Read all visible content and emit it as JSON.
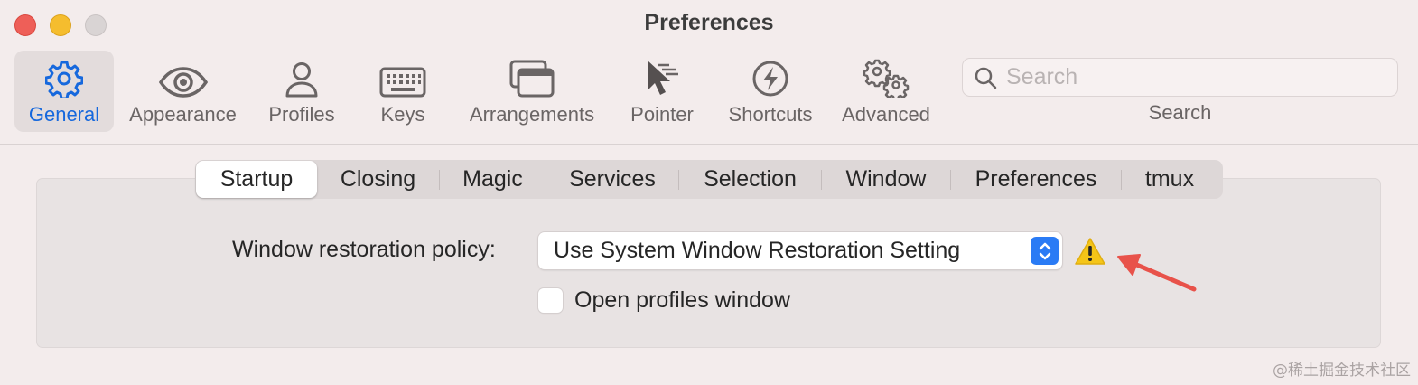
{
  "window": {
    "title": "Preferences"
  },
  "toolbar": {
    "items": [
      {
        "label": "General",
        "icon": "gear-icon",
        "active": true
      },
      {
        "label": "Appearance",
        "icon": "eye-icon",
        "active": false
      },
      {
        "label": "Profiles",
        "icon": "person-icon",
        "active": false
      },
      {
        "label": "Keys",
        "icon": "keyboard-icon",
        "active": false
      },
      {
        "label": "Arrangements",
        "icon": "windows-stack-icon",
        "active": false
      },
      {
        "label": "Pointer",
        "icon": "pointer-icon",
        "active": false
      },
      {
        "label": "Shortcuts",
        "icon": "lightning-icon",
        "active": false
      },
      {
        "label": "Advanced",
        "icon": "gears-icon",
        "active": false
      }
    ],
    "search": {
      "placeholder": "Search",
      "caption": "Search"
    }
  },
  "tabs": [
    {
      "label": "Startup",
      "active": true
    },
    {
      "label": "Closing",
      "active": false
    },
    {
      "label": "Magic",
      "active": false
    },
    {
      "label": "Services",
      "active": false
    },
    {
      "label": "Selection",
      "active": false
    },
    {
      "label": "Window",
      "active": false
    },
    {
      "label": "Preferences",
      "active": false
    },
    {
      "label": "tmux",
      "active": false
    }
  ],
  "startup": {
    "restoration_label": "Window restoration policy:",
    "restoration_value": "Use System Window Restoration Setting",
    "open_profiles_label": "Open profiles window",
    "open_profiles_checked": false
  },
  "watermark": "@稀土掘金技术社区",
  "colors": {
    "accent": "#1668dd",
    "warning": "#f5c518",
    "annotation_arrow": "#e8524a"
  }
}
